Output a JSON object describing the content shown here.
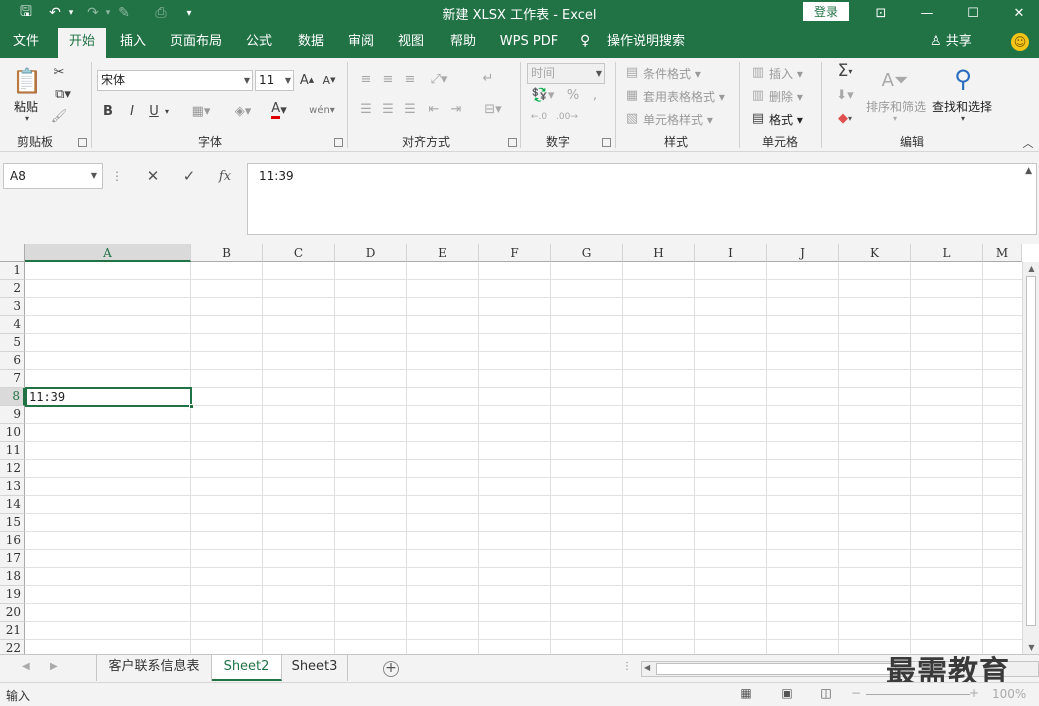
{
  "window": {
    "title": "新建 XLSX 工作表  -  Excel",
    "login_label": "登录",
    "quick_access": {
      "save": "🖫",
      "undo": "↶",
      "redo": "↷",
      "format_painter": "✎",
      "preview": "⎙",
      "customize": "▾"
    },
    "controls": {
      "ribbon_options": "⊡",
      "minimize": "—",
      "maximize": "☐",
      "close": "✕"
    }
  },
  "ribbon_tabs": [
    {
      "label": "文件",
      "active": false
    },
    {
      "label": "开始",
      "active": true
    },
    {
      "label": "插入",
      "active": false
    },
    {
      "label": "页面布局",
      "active": false
    },
    {
      "label": "公式",
      "active": false
    },
    {
      "label": "数据",
      "active": false
    },
    {
      "label": "审阅",
      "active": false
    },
    {
      "label": "视图",
      "active": false
    },
    {
      "label": "帮助",
      "active": false
    },
    {
      "label": "WPS PDF",
      "active": false
    }
  ],
  "tell_me": "操作说明搜索",
  "share_label": "共享",
  "ribbon": {
    "clipboard": {
      "paste_label": "粘贴",
      "group_label": "剪贴板"
    },
    "font": {
      "font_name": "宋体",
      "font_size": "11",
      "group_label": "字体",
      "bold": "B",
      "italic": "I",
      "underline": "U"
    },
    "alignment": {
      "group_label": "对齐方式"
    },
    "number": {
      "format_value": "时间",
      "group_label": "数字"
    },
    "styles": {
      "conditional_format": "条件格式",
      "format_as_table": "套用表格格式",
      "cell_styles": "单元格样式",
      "group_label": "样式"
    },
    "cells": {
      "insert": "插入",
      "delete": "删除",
      "format": "格式",
      "group_label": "单元格"
    },
    "editing": {
      "sort_filter": "排序和筛选",
      "find_select": "查找和选择",
      "group_label": "编辑"
    }
  },
  "formula_bar": {
    "name_box": "A8",
    "cancel": "✕",
    "enter": "✓",
    "fx": "fx",
    "content": "11:39"
  },
  "sheet": {
    "columns": [
      "A",
      "B",
      "C",
      "D",
      "E",
      "F",
      "G",
      "H",
      "I",
      "J",
      "K",
      "L",
      "M"
    ],
    "rows": [
      "1",
      "2",
      "3",
      "4",
      "5",
      "6",
      "7",
      "8",
      "9",
      "10",
      "11",
      "12",
      "13",
      "14",
      "15",
      "16",
      "17",
      "18",
      "19",
      "20",
      "21",
      "22"
    ],
    "selected_column": "A",
    "selected_row": "8",
    "cell_A8": "11:39"
  },
  "sheet_tabs": [
    {
      "label": "客户联系信息表",
      "active": false
    },
    {
      "label": "Sheet2",
      "active": true
    },
    {
      "label": "Sheet3",
      "active": false
    }
  ],
  "watermark": "最需教育",
  "status": {
    "mode": "输入",
    "zoom": "100%"
  },
  "colors": {
    "accent": "#217346",
    "ribbon_bg": "#f3f3f3",
    "grid_line": "#e1e1e1"
  }
}
